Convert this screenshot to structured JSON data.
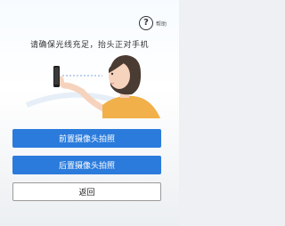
{
  "help": {
    "icon": "question-circle-icon",
    "label": "帮助"
  },
  "instruction": "请确保光线充足，抬头正对手机",
  "illustration": {
    "icon": "person-holding-phone-illustration"
  },
  "buttons": {
    "front_camera": "前置摄像头拍照",
    "rear_camera": "后置摄像头拍照",
    "back": "返回"
  },
  "colors": {
    "primary": "#2b7bdc",
    "skin": "#f6d3bd",
    "shirt": "#f2b04a"
  }
}
